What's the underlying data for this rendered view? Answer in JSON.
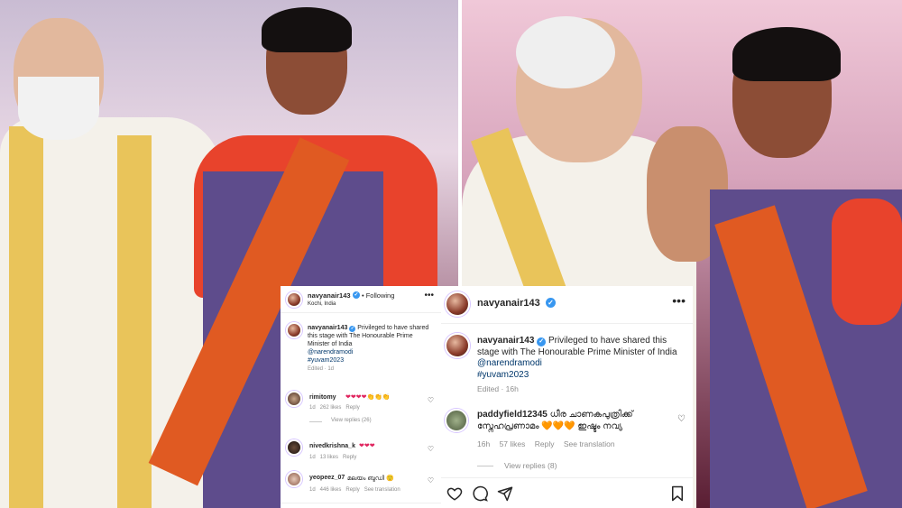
{
  "small_post": {
    "username": "navyanair143",
    "following": "• Following",
    "location": "Kochi, India",
    "caption_user": "navyanair143",
    "caption_text": "Privileged to have shared this stage with The Honourable Prime Minister of India",
    "mention": "@narendramodi",
    "hashtag": "#yuvam2023",
    "edited": "Edited · 1d",
    "comments": [
      {
        "user": "rimitomy",
        "text": "❤❤❤❤👏👏👏",
        "meta": "1d   262 likes   Reply",
        "replies": "View replies (26)"
      },
      {
        "user": "nivedkrishna_k",
        "text": "❤❤❤",
        "meta": "1d   13 likes   Reply",
        "replies": ""
      },
      {
        "user": "yeopeez_07",
        "text": "മലയം ബുഡി 🙂",
        "meta": "1d   446 likes   Reply   See translation",
        "replies": ""
      }
    ]
  },
  "large_post": {
    "username": "navyanair143",
    "caption_user": "navyanair143",
    "caption_text": "Privileged to have shared this stage with The Honourable Prime Minister of India",
    "mention": "@narendramodi",
    "hashtag": "#yuvam2023",
    "edited": "Edited · 16h",
    "comment": {
      "user": "paddyfield12345",
      "text_line1": "ധീര ചാണകപുത്രിക്ക്",
      "text_line2": "സ്നേഹപ്രണാമം 🧡🧡🧡 ഇഷ്ടം നവ്യ",
      "time": "16h",
      "likes": "57 likes",
      "reply": "Reply",
      "translation": "See translation",
      "replies": "View replies (8)"
    }
  }
}
